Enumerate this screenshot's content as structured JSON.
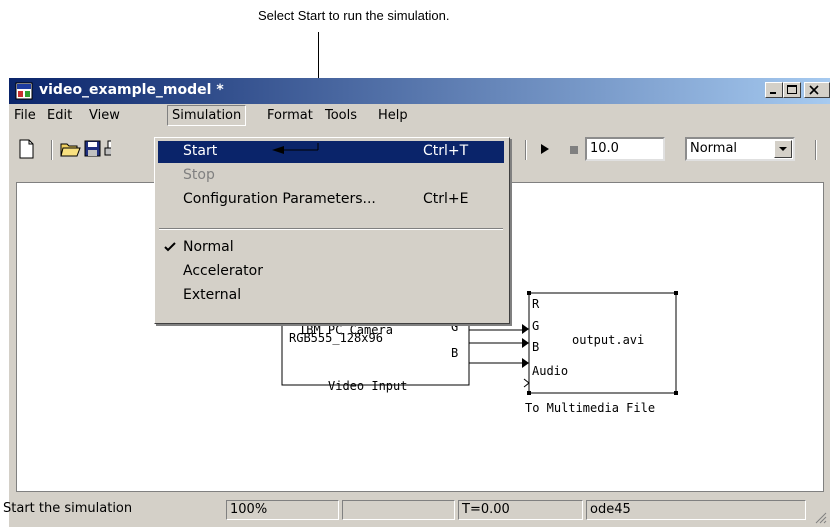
{
  "callout": {
    "text": "Select Start to run the simulation."
  },
  "window": {
    "title": "video_example_model *",
    "controls": {
      "minimize": "_",
      "maximize": "□",
      "close": "X"
    }
  },
  "menubar": {
    "items": [
      {
        "label": "File"
      },
      {
        "label": "Edit"
      },
      {
        "label": "View"
      },
      {
        "label": "Simulation"
      },
      {
        "label": "Format"
      },
      {
        "label": "Tools"
      },
      {
        "label": "Help"
      }
    ]
  },
  "toolbar": {
    "stop_time": "10.0",
    "mode": "Normal",
    "icons": [
      "new-icon",
      "open-icon",
      "save-icon",
      "print-icon",
      "play-icon",
      "stop-icon"
    ]
  },
  "simulation_menu": {
    "items": [
      {
        "label": "Start",
        "shortcut": "Ctrl+T",
        "state": "highlighted"
      },
      {
        "label": "Stop",
        "shortcut": "",
        "state": "disabled"
      },
      {
        "label": "Configuration Parameters...",
        "shortcut": "Ctrl+E",
        "state": "normal"
      },
      {
        "label": "Normal",
        "shortcut": "",
        "state": "checked"
      },
      {
        "label": "Accelerator",
        "shortcut": "",
        "state": "normal"
      },
      {
        "label": "External",
        "shortcut": "",
        "state": "normal"
      }
    ]
  },
  "diagram": {
    "video_input": {
      "line1": "IBM PC Camera",
      "line2": "RGB555_128x96",
      "port_g": "G",
      "port_b": "B",
      "caption": "Video Input"
    },
    "mm_file": {
      "ports": [
        "R",
        "G",
        "B",
        "Audio"
      ],
      "filename": "output.avi",
      "caption": "To Multimedia File"
    }
  },
  "statusbar": {
    "message": "Start the simulation",
    "zoom": "100%",
    "blank": "",
    "time": "T=0.00",
    "solver": "ode45"
  }
}
